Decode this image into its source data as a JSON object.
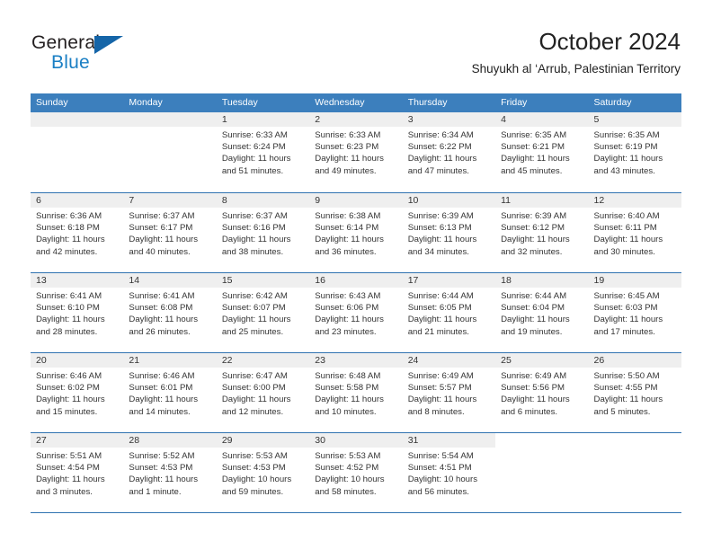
{
  "brand": {
    "name_top": "General",
    "name_bottom": "Blue",
    "accent_color": "#1a7fc4",
    "triangle_color": "#1565a8"
  },
  "header": {
    "title": "October 2024",
    "subtitle": "Shuyukh al ‘Arrub, Palestinian Territory"
  },
  "calendar": {
    "header_bg": "#3c7fbd",
    "row_divider_color": "#2f72b0",
    "day_strip_bg": "#efefef",
    "weekdays": [
      "Sunday",
      "Monday",
      "Tuesday",
      "Wednesday",
      "Thursday",
      "Friday",
      "Saturday"
    ],
    "weeks": [
      [
        {
          "day": "",
          "blank": true,
          "lines": []
        },
        {
          "day": "",
          "blank": true,
          "lines": []
        },
        {
          "day": "1",
          "lines": [
            "Sunrise: 6:33 AM",
            "Sunset: 6:24 PM",
            "Daylight: 11 hours",
            "and 51 minutes."
          ]
        },
        {
          "day": "2",
          "lines": [
            "Sunrise: 6:33 AM",
            "Sunset: 6:23 PM",
            "Daylight: 11 hours",
            "and 49 minutes."
          ]
        },
        {
          "day": "3",
          "lines": [
            "Sunrise: 6:34 AM",
            "Sunset: 6:22 PM",
            "Daylight: 11 hours",
            "and 47 minutes."
          ]
        },
        {
          "day": "4",
          "lines": [
            "Sunrise: 6:35 AM",
            "Sunset: 6:21 PM",
            "Daylight: 11 hours",
            "and 45 minutes."
          ]
        },
        {
          "day": "5",
          "lines": [
            "Sunrise: 6:35 AM",
            "Sunset: 6:19 PM",
            "Daylight: 11 hours",
            "and 43 minutes."
          ]
        }
      ],
      [
        {
          "day": "6",
          "lines": [
            "Sunrise: 6:36 AM",
            "Sunset: 6:18 PM",
            "Daylight: 11 hours",
            "and 42 minutes."
          ]
        },
        {
          "day": "7",
          "lines": [
            "Sunrise: 6:37 AM",
            "Sunset: 6:17 PM",
            "Daylight: 11 hours",
            "and 40 minutes."
          ]
        },
        {
          "day": "8",
          "lines": [
            "Sunrise: 6:37 AM",
            "Sunset: 6:16 PM",
            "Daylight: 11 hours",
            "and 38 minutes."
          ]
        },
        {
          "day": "9",
          "lines": [
            "Sunrise: 6:38 AM",
            "Sunset: 6:14 PM",
            "Daylight: 11 hours",
            "and 36 minutes."
          ]
        },
        {
          "day": "10",
          "lines": [
            "Sunrise: 6:39 AM",
            "Sunset: 6:13 PM",
            "Daylight: 11 hours",
            "and 34 minutes."
          ]
        },
        {
          "day": "11",
          "lines": [
            "Sunrise: 6:39 AM",
            "Sunset: 6:12 PM",
            "Daylight: 11 hours",
            "and 32 minutes."
          ]
        },
        {
          "day": "12",
          "lines": [
            "Sunrise: 6:40 AM",
            "Sunset: 6:11 PM",
            "Daylight: 11 hours",
            "and 30 minutes."
          ]
        }
      ],
      [
        {
          "day": "13",
          "lines": [
            "Sunrise: 6:41 AM",
            "Sunset: 6:10 PM",
            "Daylight: 11 hours",
            "and 28 minutes."
          ]
        },
        {
          "day": "14",
          "lines": [
            "Sunrise: 6:41 AM",
            "Sunset: 6:08 PM",
            "Daylight: 11 hours",
            "and 26 minutes."
          ]
        },
        {
          "day": "15",
          "lines": [
            "Sunrise: 6:42 AM",
            "Sunset: 6:07 PM",
            "Daylight: 11 hours",
            "and 25 minutes."
          ]
        },
        {
          "day": "16",
          "lines": [
            "Sunrise: 6:43 AM",
            "Sunset: 6:06 PM",
            "Daylight: 11 hours",
            "and 23 minutes."
          ]
        },
        {
          "day": "17",
          "lines": [
            "Sunrise: 6:44 AM",
            "Sunset: 6:05 PM",
            "Daylight: 11 hours",
            "and 21 minutes."
          ]
        },
        {
          "day": "18",
          "lines": [
            "Sunrise: 6:44 AM",
            "Sunset: 6:04 PM",
            "Daylight: 11 hours",
            "and 19 minutes."
          ]
        },
        {
          "day": "19",
          "lines": [
            "Sunrise: 6:45 AM",
            "Sunset: 6:03 PM",
            "Daylight: 11 hours",
            "and 17 minutes."
          ]
        }
      ],
      [
        {
          "day": "20",
          "lines": [
            "Sunrise: 6:46 AM",
            "Sunset: 6:02 PM",
            "Daylight: 11 hours",
            "and 15 minutes."
          ]
        },
        {
          "day": "21",
          "lines": [
            "Sunrise: 6:46 AM",
            "Sunset: 6:01 PM",
            "Daylight: 11 hours",
            "and 14 minutes."
          ]
        },
        {
          "day": "22",
          "lines": [
            "Sunrise: 6:47 AM",
            "Sunset: 6:00 PM",
            "Daylight: 11 hours",
            "and 12 minutes."
          ]
        },
        {
          "day": "23",
          "lines": [
            "Sunrise: 6:48 AM",
            "Sunset: 5:58 PM",
            "Daylight: 11 hours",
            "and 10 minutes."
          ]
        },
        {
          "day": "24",
          "lines": [
            "Sunrise: 6:49 AM",
            "Sunset: 5:57 PM",
            "Daylight: 11 hours",
            "and 8 minutes."
          ]
        },
        {
          "day": "25",
          "lines": [
            "Sunrise: 6:49 AM",
            "Sunset: 5:56 PM",
            "Daylight: 11 hours",
            "and 6 minutes."
          ]
        },
        {
          "day": "26",
          "lines": [
            "Sunrise: 5:50 AM",
            "Sunset: 4:55 PM",
            "Daylight: 11 hours",
            "and 5 minutes."
          ]
        }
      ],
      [
        {
          "day": "27",
          "lines": [
            "Sunrise: 5:51 AM",
            "Sunset: 4:54 PM",
            "Daylight: 11 hours",
            "and 3 minutes."
          ]
        },
        {
          "day": "28",
          "lines": [
            "Sunrise: 5:52 AM",
            "Sunset: 4:53 PM",
            "Daylight: 11 hours",
            "and 1 minute."
          ]
        },
        {
          "day": "29",
          "lines": [
            "Sunrise: 5:53 AM",
            "Sunset: 4:53 PM",
            "Daylight: 10 hours",
            "and 59 minutes."
          ]
        },
        {
          "day": "30",
          "lines": [
            "Sunrise: 5:53 AM",
            "Sunset: 4:52 PM",
            "Daylight: 10 hours",
            "and 58 minutes."
          ]
        },
        {
          "day": "31",
          "lines": [
            "Sunrise: 5:54 AM",
            "Sunset: 4:51 PM",
            "Daylight: 10 hours",
            "and 56 minutes."
          ]
        },
        {
          "day": "",
          "trailing": true,
          "lines": []
        },
        {
          "day": "",
          "trailing": true,
          "lines": []
        }
      ]
    ]
  }
}
